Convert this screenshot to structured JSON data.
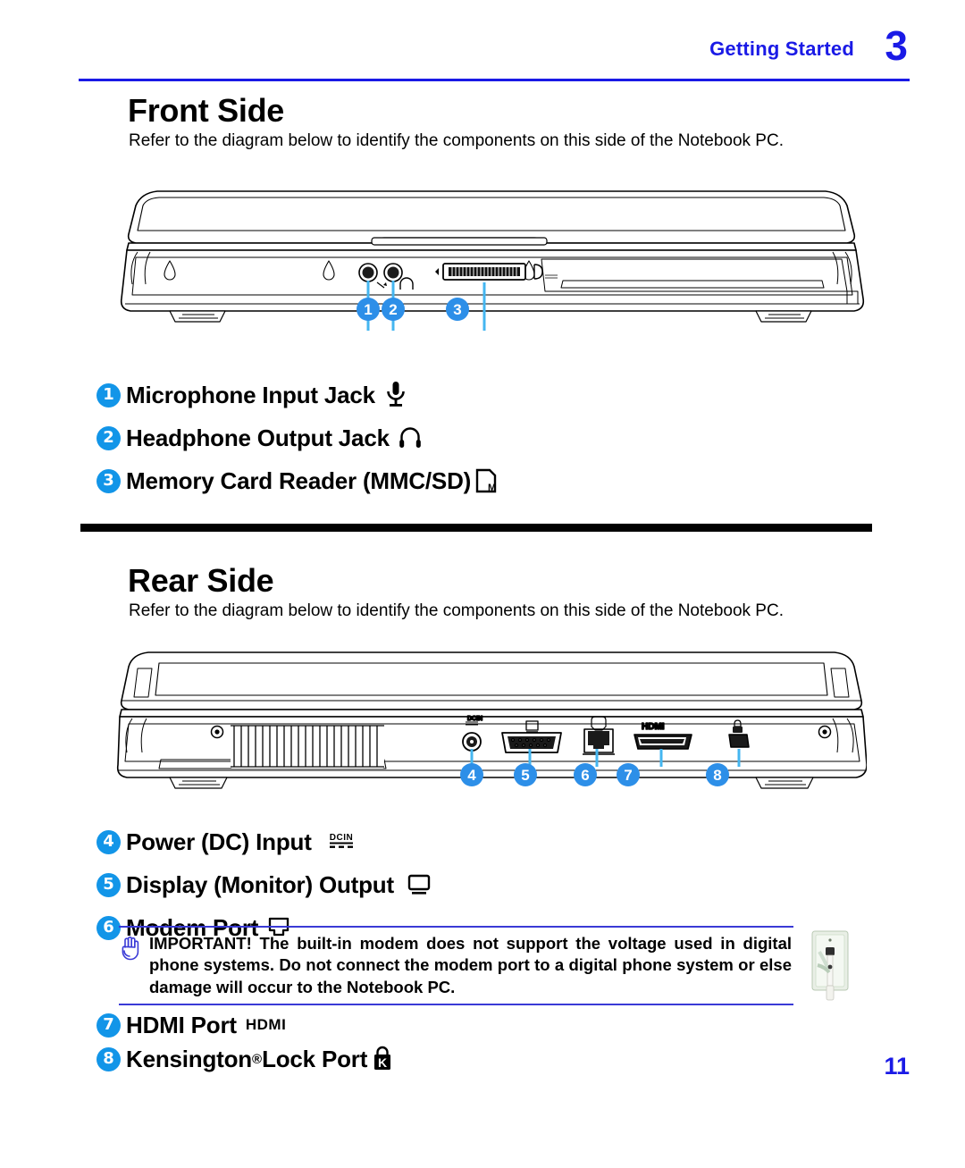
{
  "header": {
    "chapter_title": "Getting Started",
    "chapter_number": "3",
    "accent_color": "#1a1ae6"
  },
  "page_number": "11",
  "sections": [
    {
      "title": "Front Side",
      "description": "Refer to the diagram below to identify the components on this side of the Notebook PC.",
      "diagram_callouts": [
        "1",
        "2",
        "3"
      ],
      "features": [
        {
          "number": "1",
          "label": "Microphone Input Jack",
          "icon": "microphone-icon"
        },
        {
          "number": "2",
          "label": "Headphone Output Jack",
          "icon": "headphone-icon"
        },
        {
          "number": "3",
          "label": "Memory Card Reader (MMC/SD)",
          "icon": "memory-card-icon"
        }
      ]
    },
    {
      "title": "Rear Side",
      "description": "Refer to the diagram below to identify the components on this side of the Notebook PC.",
      "diagram_callouts": [
        "4",
        "5",
        "6",
        "7",
        "8"
      ],
      "features_top": [
        {
          "number": "4",
          "label": "Power (DC) Input",
          "icon": "dcin-icon",
          "icon_text": "DCIN"
        },
        {
          "number": "5",
          "label": "Display (Monitor) Output",
          "icon": "monitor-icon"
        },
        {
          "number": "6",
          "label": "Modem Port",
          "icon": "modem-port-icon"
        }
      ],
      "features_bottom": [
        {
          "number": "7",
          "label": "HDMI Port",
          "icon": "hdmi-icon",
          "icon_text": "HDMI"
        },
        {
          "number": "8",
          "label": "Kensington",
          "label_suffix": " Lock Port",
          "registered": "®",
          "icon": "kensington-lock-icon"
        }
      ]
    }
  ],
  "note": {
    "icon": "stop-hand-icon",
    "prefix": "IMPORTANT!",
    "text": "IMPORTANT!   The built-in modem does not support the voltage used in digital phone systems. Do not connect the modem port to a digital phone system or else damage will occur to the Notebook PC.",
    "photo": "wall-phone-jack-photo",
    "rule_color": "#3a3ad6"
  },
  "diagram_labels": {
    "front_port_hint": "D",
    "rear_hdmi": "HDMI",
    "rear_dcin": "DCIN"
  }
}
